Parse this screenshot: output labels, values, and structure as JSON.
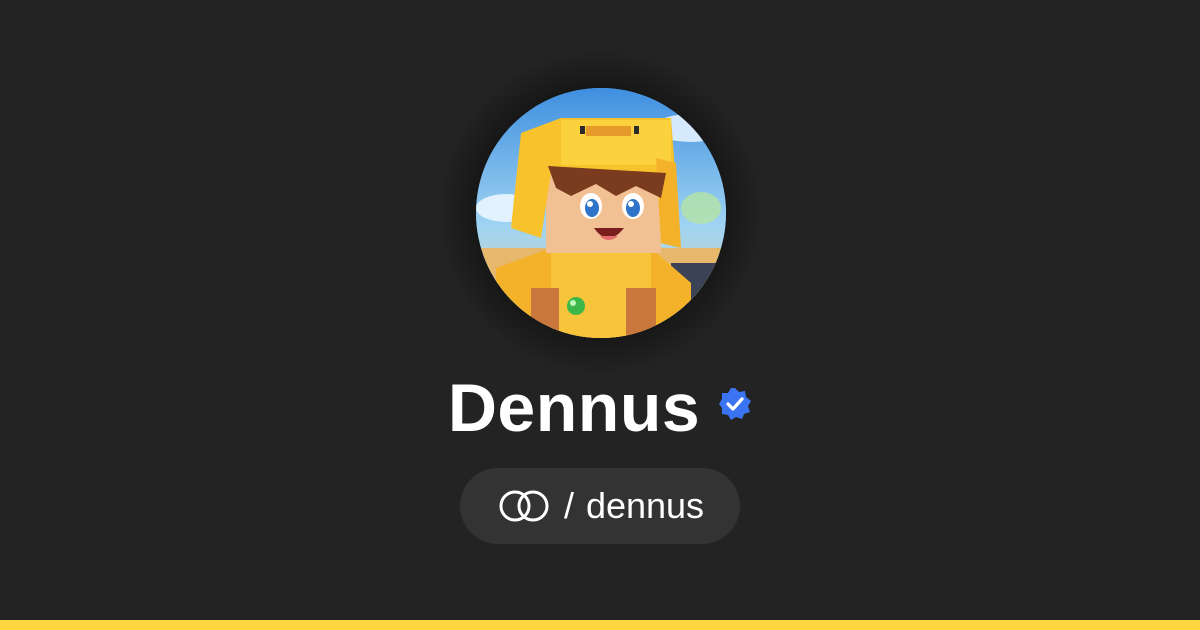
{
  "profile": {
    "display_name": "Dennus",
    "verified": true,
    "verified_icon": "verified-badge-icon",
    "avatar_description_icon": "avatar-image",
    "handle_separator": "/",
    "handle": "dennus",
    "platform_icon": "linked-rings-logo-icon"
  },
  "colors": {
    "background": "#232323",
    "pill_background": "#333333",
    "accent_bar": "#fcd53f",
    "verified_badge": "#3b74f2",
    "text": "#ffffff"
  }
}
